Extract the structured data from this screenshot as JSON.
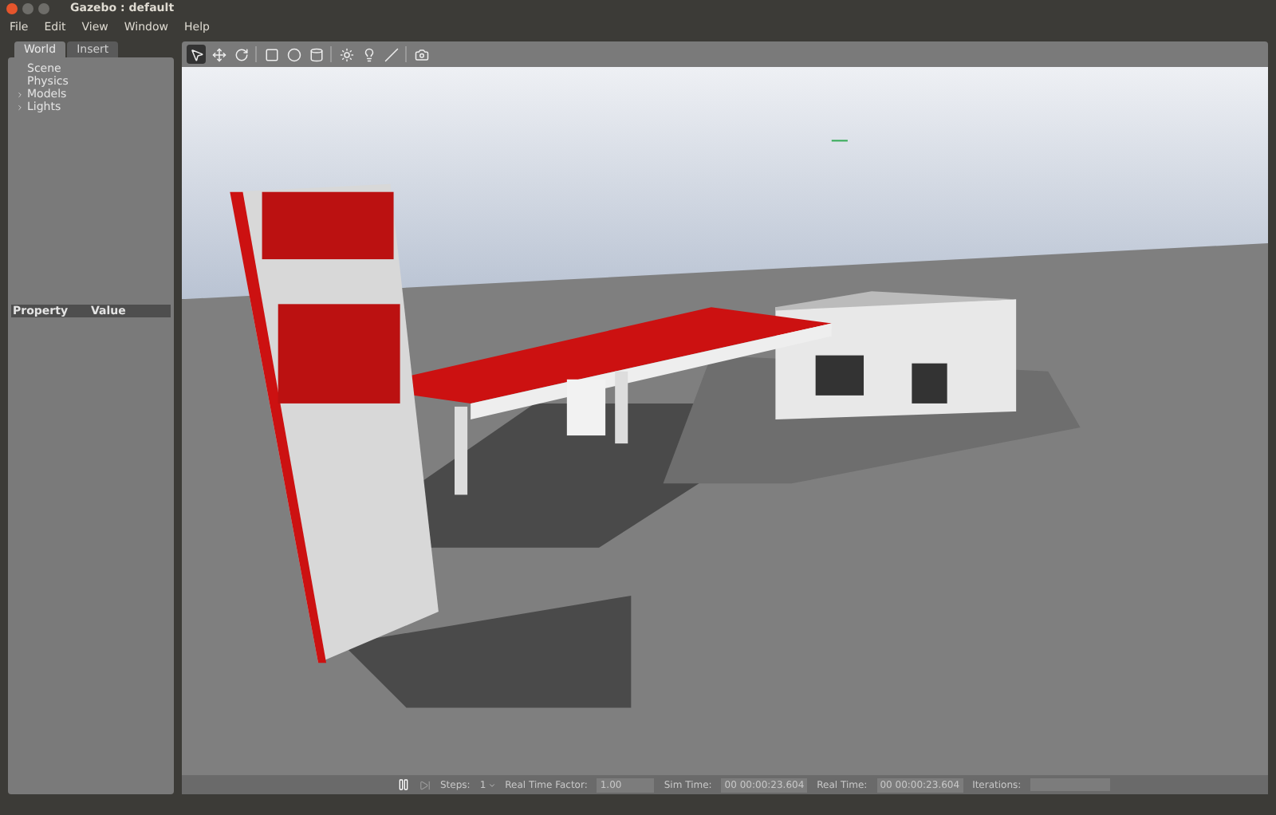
{
  "window": {
    "title": "Gazebo : default"
  },
  "menu": [
    "File",
    "Edit",
    "View",
    "Window",
    "Help"
  ],
  "left_panel": {
    "tabs": [
      {
        "label": "World",
        "selected": true
      },
      {
        "label": "Insert",
        "selected": false
      }
    ],
    "tree": [
      {
        "label": "Scene",
        "kind": "leaf"
      },
      {
        "label": "Physics",
        "kind": "leaf"
      },
      {
        "label": "Models",
        "kind": "group",
        "expanded": false
      },
      {
        "label": "Lights",
        "kind": "group",
        "expanded": false
      }
    ],
    "property_table": {
      "columns": [
        "Property",
        "Value"
      ]
    }
  },
  "toolbar": {
    "tools": [
      {
        "kind": "select",
        "selected": true
      },
      {
        "kind": "translate",
        "selected": false
      },
      {
        "kind": "rotate",
        "selected": false
      },
      {
        "kind": "divider"
      },
      {
        "kind": "box",
        "selected": false
      },
      {
        "kind": "sphere",
        "selected": false
      },
      {
        "kind": "cylinder",
        "selected": false
      },
      {
        "kind": "divider"
      },
      {
        "kind": "point_light",
        "selected": false
      },
      {
        "kind": "spot_light",
        "selected": false
      },
      {
        "kind": "directional_light",
        "selected": false
      },
      {
        "kind": "divider"
      },
      {
        "kind": "screenshot",
        "selected": false
      }
    ]
  },
  "bottom_bar": {
    "paused": false,
    "steps_label": "Steps:",
    "steps_value": "1",
    "rtf_label": "Real Time Factor:",
    "rtf_value": "1.00",
    "sim_time_label": "Sim Time:",
    "sim_time_value": "00 00:00:23.604",
    "real_time_label": "Real Time:",
    "real_time_value": "00 00:00:23.604",
    "iterations_label": "Iterations:"
  }
}
